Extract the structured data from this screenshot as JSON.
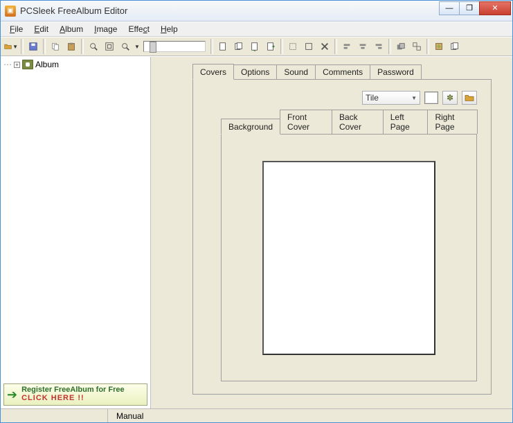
{
  "window": {
    "title": "PCSleek FreeAlbum Editor"
  },
  "winbtns": {
    "min": "—",
    "max": "❐",
    "close": "✕"
  },
  "menu": {
    "file": "File",
    "edit": "Edit",
    "album": "Album",
    "image": "Image",
    "effect": "Effect",
    "help": "Help"
  },
  "toolbar_icons": {
    "open": "open-icon",
    "save": "save-icon",
    "copy": "copy-icon",
    "paste": "paste-icon",
    "zoomin": "zoom-in-icon",
    "fit": "fit-screen-icon",
    "zoomout": "zoom-out-icon",
    "newpage": "new-page-icon",
    "pages": "page-stack-icon",
    "duplicate": "duplicate-page-icon",
    "nextpage": "next-page-icon",
    "stamp": "stamp-icon",
    "rect": "rect-select-icon",
    "delete": "delete-icon",
    "alignl": "align-left-icon",
    "alignc": "align-center-icon",
    "alignr": "align-right-icon",
    "layers": "layers-icon",
    "ungroup": "ungroup-icon",
    "publish": "publish-icon",
    "copypg": "copy-page-icon"
  },
  "tree": {
    "root": "Album"
  },
  "register": {
    "line1": "Register FreeAlbum for Free",
    "line2": "CLICK HERE !!"
  },
  "tabs": {
    "items": [
      "Covers",
      "Options",
      "Sound",
      "Comments",
      "Password"
    ],
    "active": 0
  },
  "tile_combo": {
    "value": "Tile"
  },
  "subtabs": {
    "items": [
      "Background",
      "Front Cover",
      "Back Cover",
      "Left Page",
      "Right Page"
    ],
    "active": 0
  },
  "status": {
    "cell1": "",
    "cell2": "Manual"
  }
}
